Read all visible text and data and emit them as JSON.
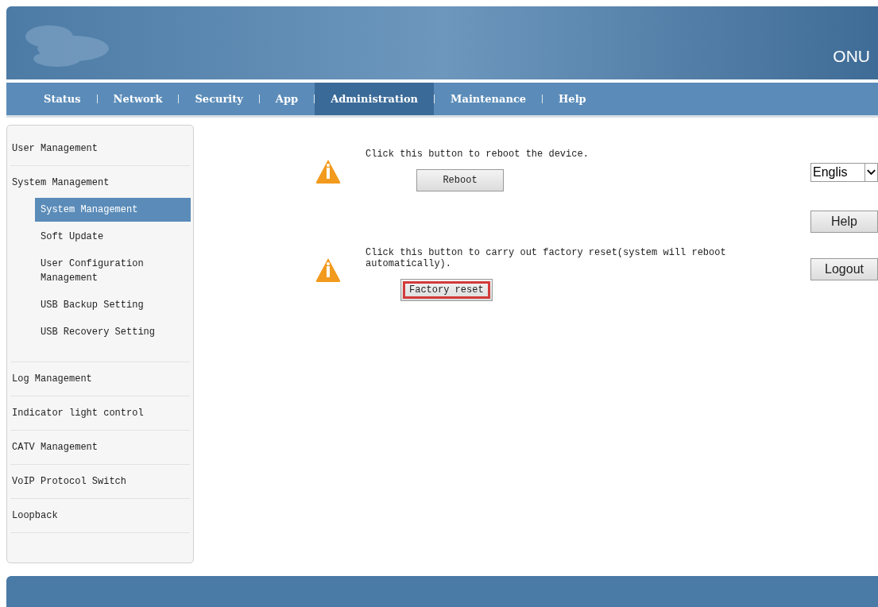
{
  "header": {
    "title": "ONU"
  },
  "tabs": [
    {
      "label": "Status",
      "selected": false
    },
    {
      "label": "Network",
      "selected": false
    },
    {
      "label": "Security",
      "selected": false
    },
    {
      "label": "App",
      "selected": false
    },
    {
      "label": "Administration",
      "selected": true
    },
    {
      "label": "Maintenance",
      "selected": false
    },
    {
      "label": "Help",
      "selected": false
    }
  ],
  "sidebar": {
    "items": [
      {
        "label": "User Management"
      },
      {
        "label": "System Management",
        "children": [
          {
            "label": "System Management",
            "selected": true
          },
          {
            "label": "Soft Update",
            "selected": false
          },
          {
            "label": "User Configuration Management",
            "selected": false
          },
          {
            "label": "USB Backup Setting",
            "selected": false
          },
          {
            "label": "USB Recovery Setting",
            "selected": false
          }
        ]
      },
      {
        "label": "Log Management"
      },
      {
        "label": "Indicator light control"
      },
      {
        "label": "CATV Management"
      },
      {
        "label": "VoIP Protocol Switch"
      },
      {
        "label": "Loopback"
      }
    ]
  },
  "actions": [
    {
      "text": "Click this button to reboot the device.",
      "button": "Reboot",
      "highlighted": false
    },
    {
      "text": "Click this button to carry out factory reset(system will reboot automatically).",
      "button": "Factory reset",
      "highlighted": true
    }
  ],
  "language_select": {
    "value": "Englis"
  },
  "side_buttons": [
    "Help",
    "Logout"
  ]
}
